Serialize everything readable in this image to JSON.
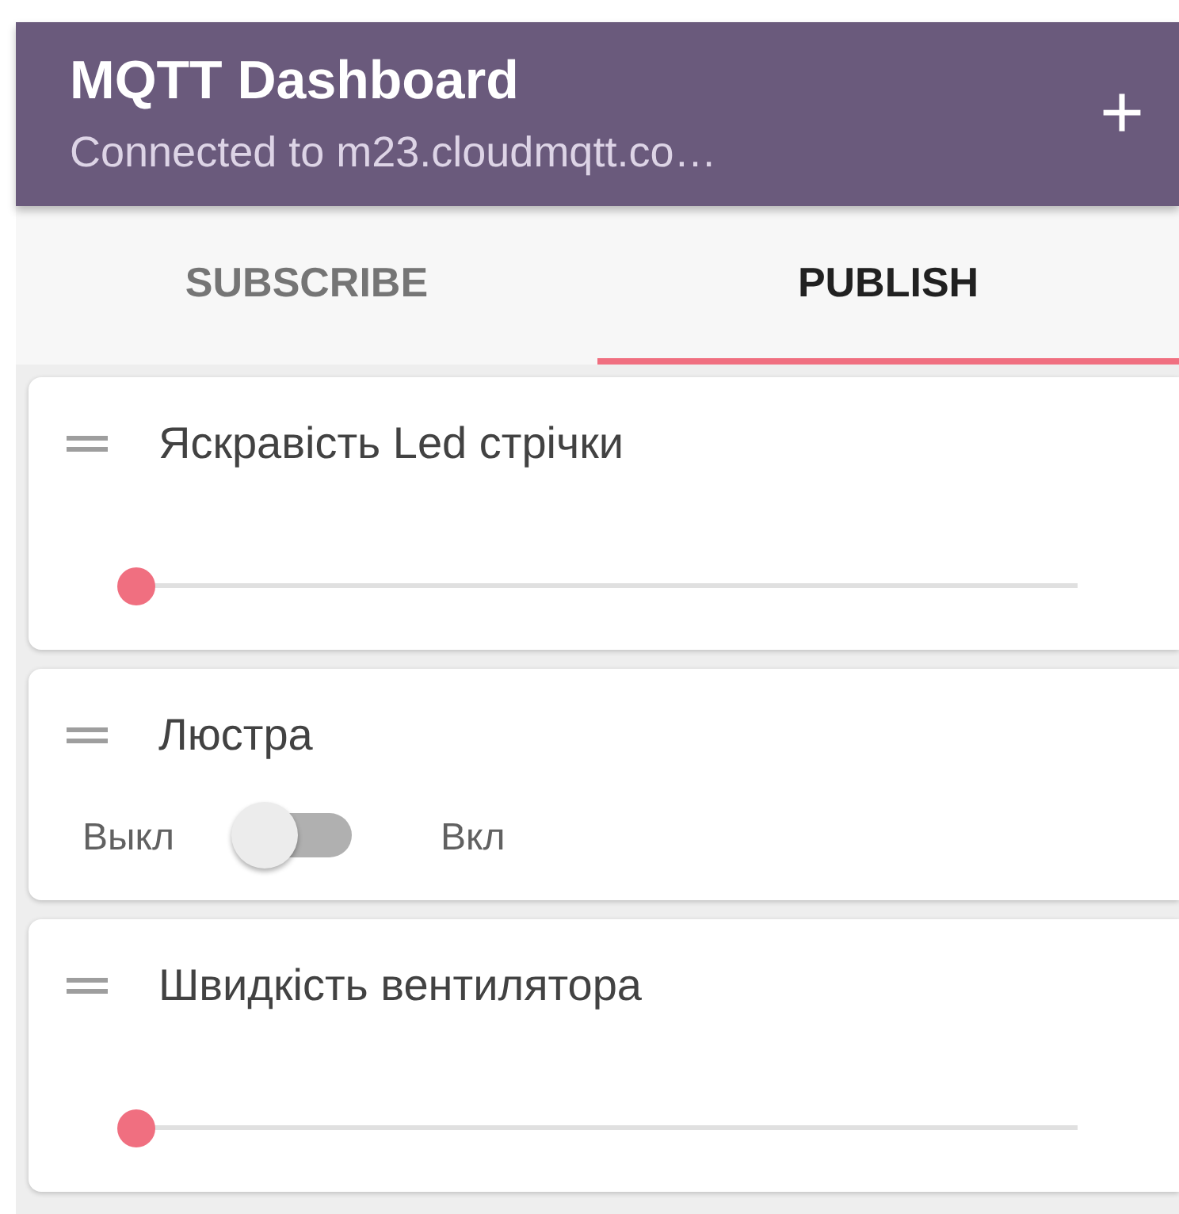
{
  "app_bar": {
    "title": "MQTT Dashboard",
    "subtitle": "Connected to m23.cloudmqtt.co…",
    "action": "+"
  },
  "tabs": [
    {
      "label": "SUBSCRIBE",
      "selected": false
    },
    {
      "label": "PUBLISH",
      "selected": true
    }
  ],
  "widgets": [
    {
      "kind": "slider",
      "title": "Яскравість Led стрічки",
      "level": 0
    },
    {
      "kind": "switch",
      "title": "Люстра",
      "off_label": "Выкл",
      "on_label": "Вкл",
      "on": false
    },
    {
      "kind": "slider",
      "title": "Швидкість вентилятора",
      "level": 0
    }
  ]
}
